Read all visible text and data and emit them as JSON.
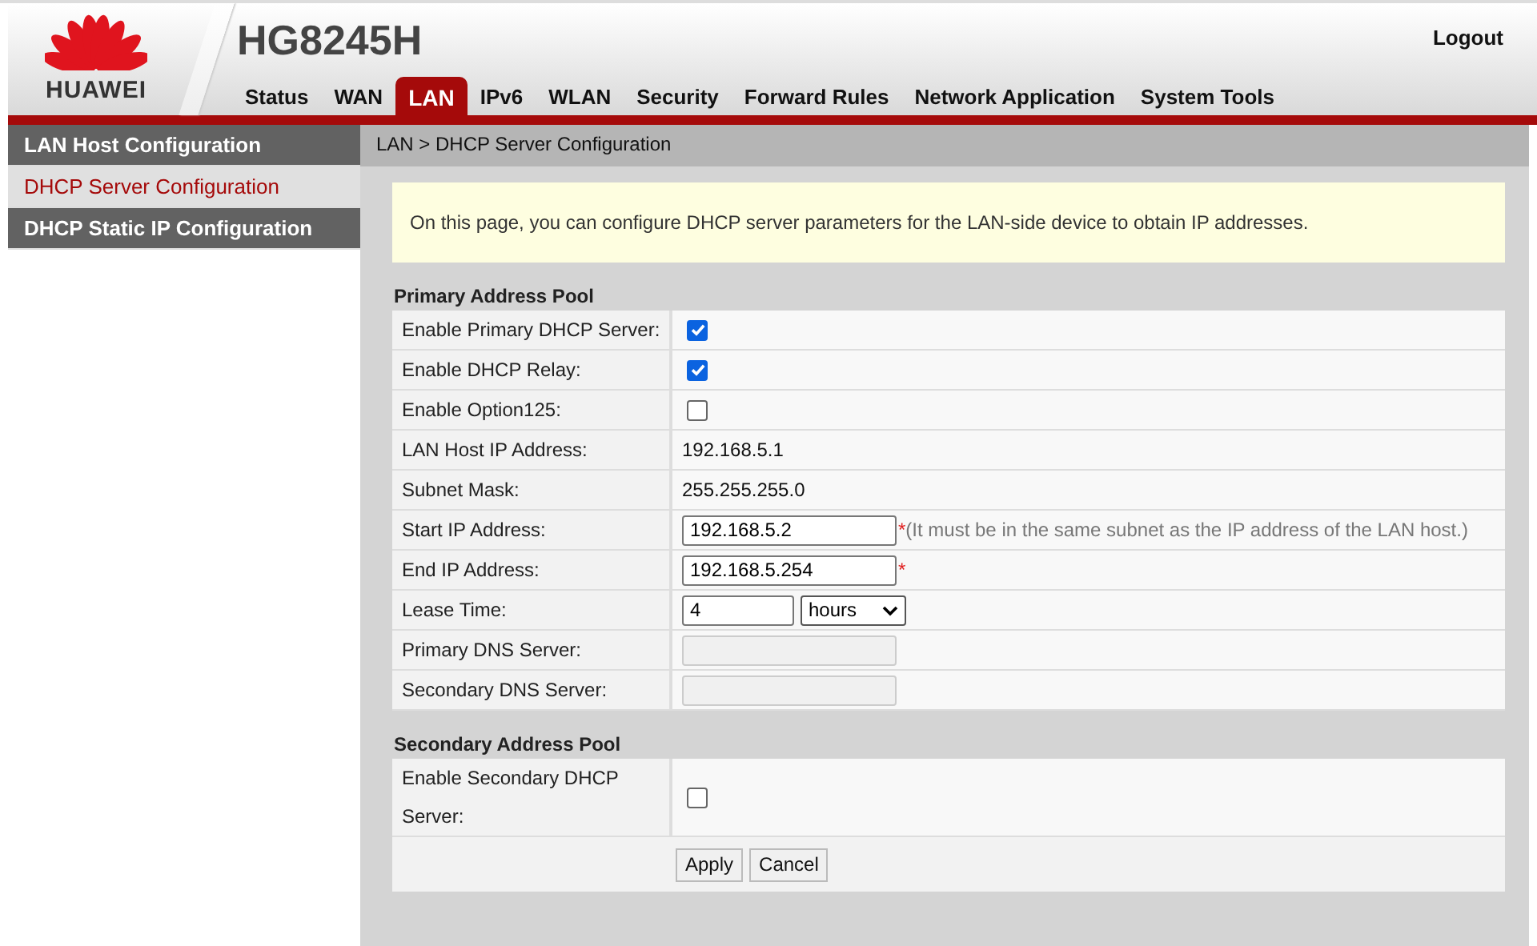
{
  "header": {
    "brand": "HUAWEI",
    "model": "HG8245H",
    "logout": "Logout"
  },
  "nav": [
    {
      "label": "Status",
      "selected": false
    },
    {
      "label": "WAN",
      "selected": false
    },
    {
      "label": "LAN",
      "selected": true
    },
    {
      "label": "IPv6",
      "selected": false
    },
    {
      "label": "WLAN",
      "selected": false
    },
    {
      "label": "Security",
      "selected": false
    },
    {
      "label": "Forward Rules",
      "selected": false
    },
    {
      "label": "Network Application",
      "selected": false
    },
    {
      "label": "System Tools",
      "selected": false
    }
  ],
  "sidebar": {
    "items": [
      {
        "label": "LAN Host Configuration",
        "selected": false
      },
      {
        "label": "DHCP Server Configuration",
        "selected": true
      },
      {
        "label": "DHCP Static IP Configuration",
        "selected": false
      }
    ]
  },
  "breadcrumb": "LAN > DHCP Server Configuration",
  "info": "On this page, you can configure DHCP server parameters for the LAN-side device to obtain IP addresses.",
  "primary_pool": {
    "title": "Primary Address Pool",
    "rows": [
      {
        "kind": "checkbox",
        "label": "Enable Primary DHCP Server:",
        "checked": true
      },
      {
        "kind": "checkbox",
        "label": "Enable DHCP Relay:",
        "checked": true
      },
      {
        "kind": "checkbox",
        "label": "Enable Option125:",
        "checked": false
      },
      {
        "kind": "text",
        "label": "LAN Host IP Address:",
        "value": "192.168.5.1"
      },
      {
        "kind": "text",
        "label": "Subnet Mask:",
        "value": "255.255.255.0"
      },
      {
        "kind": "input",
        "label": "Start IP Address:",
        "value": "192.168.5.2",
        "asterisk": "*",
        "note": "(It must be in the same subnet as the IP address of the LAN host.)"
      },
      {
        "kind": "input",
        "label": "End IP Address:",
        "value": "192.168.5.254",
        "asterisk": "*"
      },
      {
        "kind": "lease",
        "label": "Lease Time:",
        "value": "4",
        "unit": "hours"
      },
      {
        "kind": "input",
        "label": "Primary DNS Server:",
        "disabled": true
      },
      {
        "kind": "input",
        "label": "Secondary DNS Server:",
        "disabled": true
      }
    ]
  },
  "secondary_pool": {
    "title": "Secondary Address Pool",
    "rows": [
      {
        "kind": "checkbox",
        "label": "Enable Secondary DHCP Server:",
        "checked": false
      }
    ]
  },
  "buttons": [
    "Apply",
    "Cancel"
  ]
}
